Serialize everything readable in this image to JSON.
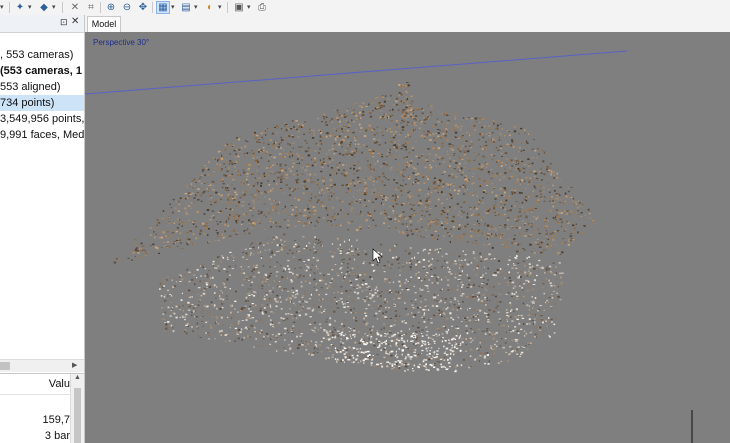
{
  "toolbar": {
    "icons": [
      "marker-icon",
      "select-icon",
      "delete-icon",
      "crop-icon",
      "zoom-in-icon",
      "zoom-out-icon",
      "move-icon",
      "grid-view-icon",
      "layers-icon",
      "shading-icon",
      "camera-icon",
      "print-icon"
    ]
  },
  "tree": {
    "items": [
      {
        "label": ", 553 cameras)",
        "bold": false,
        "selected": false
      },
      {
        "label": " (553 cameras, 1",
        "bold": true,
        "selected": false
      },
      {
        "label": "553 aligned)",
        "bold": false,
        "selected": false
      },
      {
        "label": "734 points)",
        "bold": false,
        "selected": true
      },
      {
        "label": "3,549,956 points,",
        "bold": false,
        "selected": false
      },
      {
        "label": "9,991 faces, Med",
        "bold": false,
        "selected": false
      }
    ]
  },
  "properties": {
    "header": "Valu",
    "values": [
      "159,7",
      "3 bar"
    ]
  },
  "tabs": [
    {
      "label": "Model"
    }
  ],
  "viewport": {
    "label": "Perspective 30°",
    "background": "#7f7f7f"
  }
}
